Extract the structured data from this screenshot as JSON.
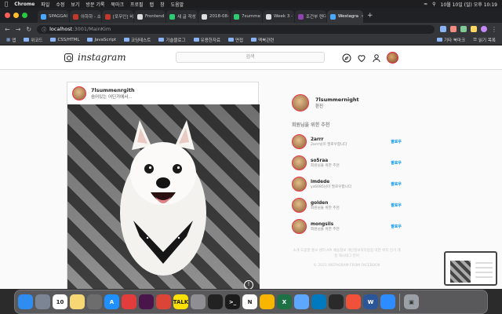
{
  "menubar": {
    "app": "Chrome",
    "items": [
      "파일",
      "수정",
      "보기",
      "방문 기록",
      "북마크",
      "프로필",
      "탭",
      "창",
      "도움말"
    ],
    "datetime": "10월 10일 (일) 오후 10:19"
  },
  "tabs": [
    {
      "label": "SPAGGAI",
      "color": "#4aa8ff"
    },
    {
      "label": "아하하 - 소",
      "color": "#c0392b"
    },
    {
      "label": "[포무인] 비",
      "color": "#c0392b"
    },
    {
      "label": "Frontend",
      "color": "#dddddd"
    },
    {
      "label": "새 글 작성",
      "color": "#2ecc71"
    },
    {
      "label": "2018-08-",
      "color": "#dddddd"
    },
    {
      "label": "7summe",
      "color": "#2ecc71"
    },
    {
      "label": "Week 3 -",
      "color": "#dddddd"
    },
    {
      "label": "조건부 렌더",
      "color": "#8e44ad"
    },
    {
      "label": "Westagra",
      "color": "#4aa8ff",
      "active": true
    }
  ],
  "address": {
    "host": "localhost",
    "path": ":3001/MainKim"
  },
  "bookmarks": {
    "items": [
      "앱",
      "위코드",
      "CSS/HTML",
      "JavaScript",
      "코딩테스트",
      "기술블로그",
      "유용한자료",
      "면접",
      "맥북관련"
    ],
    "right": [
      "기타 북마크",
      "읽기 목록"
    ]
  },
  "nav": {
    "logo": "instagram",
    "search_placeholder": "검색"
  },
  "post": {
    "username": "7lsummenrgith",
    "subtitle": "숨어있는 어딘가에서..."
  },
  "sidebar": {
    "me": {
      "username": "7lsummernight",
      "subtitle": "환진"
    },
    "rec_title": "회원님을 위한 추천",
    "recommendations": [
      {
        "username": "2arrr",
        "subtitle": "2arrr님이 팔로우합니다",
        "follow": "팔로우"
      },
      {
        "username": "so5raa",
        "subtitle": "회원님을 위한 추천",
        "follow": "팔로우"
      },
      {
        "username": "lmdede",
        "subtitle": "ys6085님이 팔로우합니다",
        "follow": "팔로우"
      },
      {
        "username": "golden",
        "subtitle": "회원님을 위한 추천",
        "follow": "팔로우"
      },
      {
        "username": "mongsils",
        "subtitle": "회원님을 위한 추천",
        "follow": "팔로우"
      }
    ],
    "footer": "소개 도움말 홍보 센터 API 채용정보 개인정보처리방침 약관 위치 인기 계정 해시태그 언어",
    "copyright": "© 2021 INSTAGRAM FROM FACEBOOK"
  },
  "dock": {
    "calendar_day": "10",
    "apps": [
      {
        "name": "finder",
        "color": "#2f8cf0",
        "glyph": ""
      },
      {
        "name": "launchpad",
        "color": "#7b8593",
        "glyph": ""
      },
      {
        "name": "calendar",
        "color": "#ffffff",
        "glyph": "10"
      },
      {
        "name": "notes",
        "color": "#f7d774",
        "glyph": ""
      },
      {
        "name": "calculator",
        "color": "#6d6d6d",
        "glyph": ""
      },
      {
        "name": "app-store",
        "color": "#1e90ff",
        "glyph": "A"
      },
      {
        "name": "flashcards",
        "color": "#e23c3c",
        "glyph": ""
      },
      {
        "name": "slack",
        "color": "#4a154b",
        "glyph": ""
      },
      {
        "name": "chrome",
        "color": "#db4437",
        "glyph": ""
      },
      {
        "name": "kakaotalk",
        "color": "#fae100",
        "glyph": "TALK"
      },
      {
        "name": "system-preferences",
        "color": "#8e8e93",
        "glyph": ""
      },
      {
        "name": "figma",
        "color": "#222222",
        "glyph": ""
      },
      {
        "name": "terminal",
        "color": "#1b1b1b",
        "glyph": ">_"
      },
      {
        "name": "notion",
        "color": "#ffffff",
        "glyph": "N"
      },
      {
        "name": "sketch",
        "color": "#f7b500",
        "glyph": ""
      },
      {
        "name": "excel",
        "color": "#1e7145",
        "glyph": "X"
      },
      {
        "name": "preview",
        "color": "#5ea7ff",
        "glyph": ""
      },
      {
        "name": "trello",
        "color": "#0079bf",
        "glyph": ""
      },
      {
        "name": "iterm",
        "color": "#2a2a2a",
        "glyph": ""
      },
      {
        "name": "swift",
        "color": "#f05138",
        "glyph": ""
      },
      {
        "name": "word",
        "color": "#2b579a",
        "glyph": "W"
      },
      {
        "name": "zoom",
        "color": "#2d8cff",
        "glyph": ""
      }
    ]
  }
}
